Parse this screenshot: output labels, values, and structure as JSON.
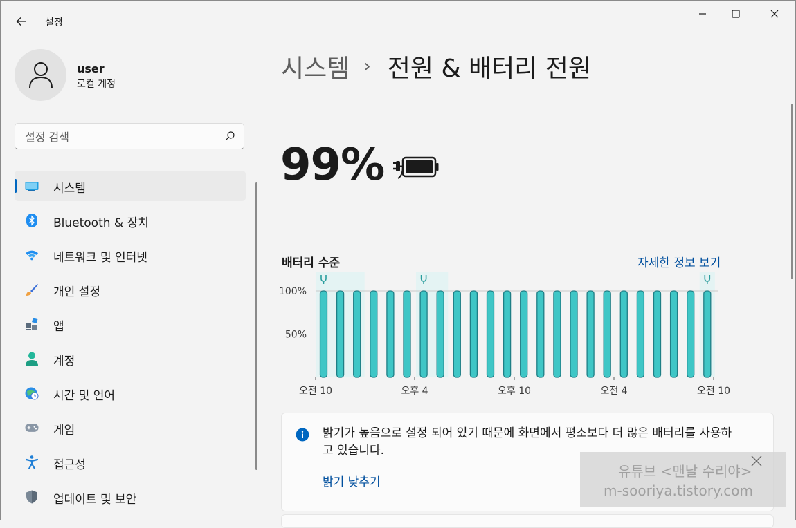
{
  "window": {
    "app_title": "설정",
    "back_icon": "back-arrow-icon",
    "controls": [
      "minimize-icon",
      "maximize-icon",
      "close-icon"
    ]
  },
  "user": {
    "name": "user",
    "account_type": "로컬 계정"
  },
  "search": {
    "placeholder": "설정 검색"
  },
  "sidebar": {
    "selected_index": 0,
    "accent_color": "#0067c0",
    "items": [
      {
        "label": "시스템",
        "icon": "system-icon"
      },
      {
        "label": "Bluetooth & 장치",
        "icon": "bluetooth-icon"
      },
      {
        "label": "네트워크 및 인터넷",
        "icon": "wifi-icon"
      },
      {
        "label": "개인 설정",
        "icon": "brush-icon"
      },
      {
        "label": "앱",
        "icon": "apps-icon"
      },
      {
        "label": "계정",
        "icon": "account-icon"
      },
      {
        "label": "시간 및 언어",
        "icon": "globe-clock-icon"
      },
      {
        "label": "게임",
        "icon": "gamepad-icon"
      },
      {
        "label": "접근성",
        "icon": "accessibility-icon"
      },
      {
        "label": "업데이트 및 보안",
        "icon": "shield-icon"
      }
    ]
  },
  "breadcrumb": {
    "parent": "시스템",
    "separator": "›",
    "current": "전원 & 배터리 전원"
  },
  "battery": {
    "percent": "99%",
    "status_icon": "battery-charging-icon"
  },
  "battery_chart": {
    "title": "배터리 수준",
    "details_link": "자세한 정보 보기"
  },
  "chart_data": {
    "type": "bar",
    "title": "배터리 수준",
    "y_ticks": [
      "100%",
      "50%"
    ],
    "x_tick_labels": [
      "오전 10",
      "오후 4",
      "오후 10",
      "오전 4",
      "오전 10"
    ],
    "ylim": [
      0,
      100
    ],
    "bar_color": "#3fc6c6",
    "charging_color": "#2a9d9d",
    "values": [
      100,
      100,
      100,
      100,
      100,
      100,
      100,
      100,
      100,
      100,
      100,
      100,
      100,
      100,
      100,
      100,
      100,
      100,
      100,
      100,
      100,
      100,
      100,
      100
    ],
    "charging_marker_bars": [
      0,
      6,
      23
    ],
    "charging_shaded_bars": [
      [
        0,
        2
      ],
      [
        6,
        7
      ],
      [
        23,
        23
      ]
    ]
  },
  "info_card": {
    "icon": "info-icon",
    "message": "밝기가 높음으로 설정 되어 있기 때문에 화면에서 평소보다 더 많은 배터리를 사용하고 있습니다.",
    "action": "밝기 낮추기"
  },
  "watermark": {
    "line1": "유튜브 <맨날 수리야>",
    "line2": "m-sooriya.tistory.com"
  }
}
